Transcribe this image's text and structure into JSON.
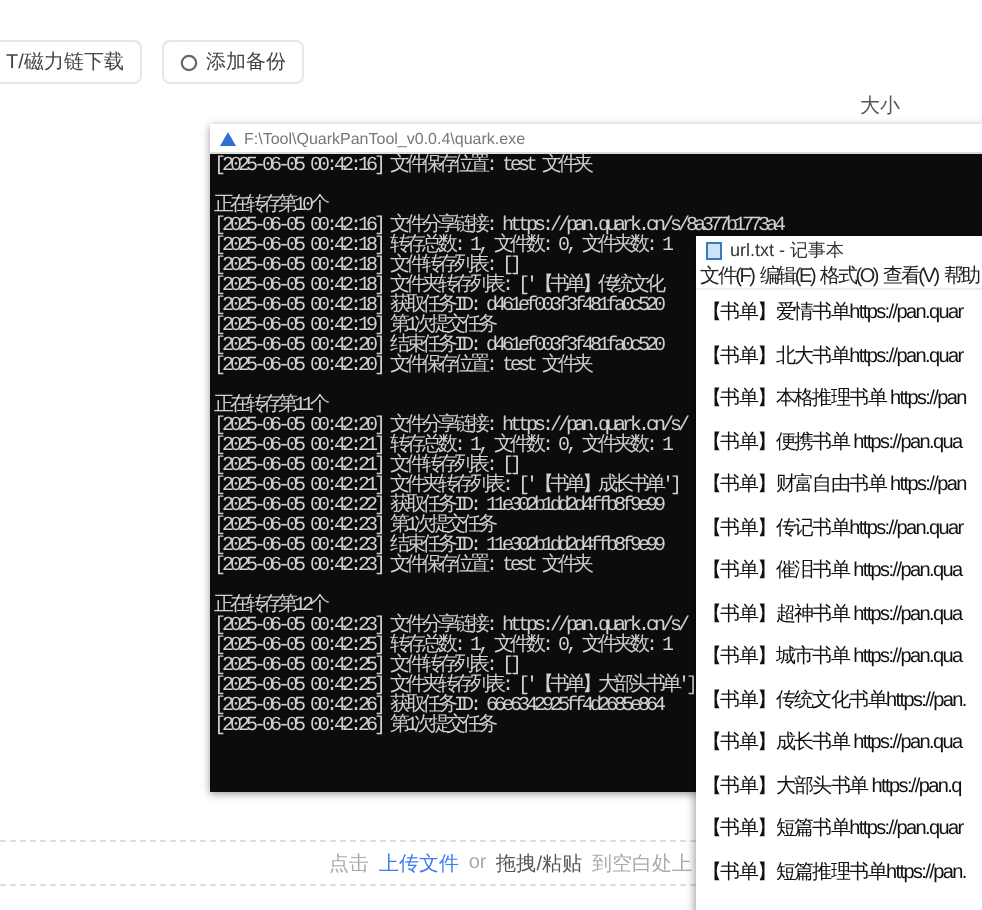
{
  "toolbar": {
    "buttons": [
      {
        "label": "T/磁力链下载",
        "kind": "plain"
      },
      {
        "label": "添加备份",
        "kind": "icon"
      }
    ]
  },
  "table": {
    "columns": [
      "大小"
    ]
  },
  "console": {
    "title": "F:\\Tool\\QuarkPanTool_v0.0.4\\quark.exe",
    "groups": [
      {
        "lines": [
          "[2025-06-05 00:42:16] 文件保存位置: test 文件夹"
        ]
      },
      {
        "heading": "正在转存第10个",
        "lines": [
          "[2025-06-05 00:42:16] 文件分享链接: https://pan.quark.cn/s/8a377b1773a4",
          "[2025-06-05 00:42:18] 转存总数: 1, 文件数: 0, 文件夹数: 1",
          "[2025-06-05 00:42:18] 文件转存列表: []",
          "[2025-06-05 00:42:18] 文件夹转存列表: ['【书单】传统文化",
          "[2025-06-05 00:42:18] 获取任务ID: d461ef003f3f481fa0c520",
          "[2025-06-05 00:42:19] 第1次提交任务",
          "[2025-06-05 00:42:20] 结束任务ID: d461ef003f3f481fa0c520",
          "[2025-06-05 00:42:20] 文件保存位置: test 文件夹"
        ]
      },
      {
        "heading": "正在转存第11个",
        "lines": [
          "[2025-06-05 00:42:20] 文件分享链接: https://pan.quark.cn/s/",
          "[2025-06-05 00:42:21] 转存总数: 1, 文件数: 0, 文件夹数: 1",
          "[2025-06-05 00:42:21] 文件转存列表: []",
          "[2025-06-05 00:42:21] 文件夹转存列表: ['【书单】成长书单']",
          "[2025-06-05 00:42:22] 获取任务ID: 11e302b1dd2d4ffb8f9e99",
          "[2025-06-05 00:42:23] 第1次提交任务",
          "[2025-06-05 00:42:23] 结束任务ID: 11e302b1dd2d4ffb8f9e99",
          "[2025-06-05 00:42:23] 文件保存位置: test 文件夹"
        ]
      },
      {
        "heading": "正在转存第12个",
        "lines": [
          "[2025-06-05 00:42:23] 文件分享链接: https://pan.quark.cn/s/",
          "[2025-06-05 00:42:25] 转存总数: 1, 文件数: 0, 文件夹数: 1",
          "[2025-06-05 00:42:25] 文件转存列表: []",
          "[2025-06-05 00:42:25] 文件夹转存列表: ['【书单】大部头书单']",
          "[2025-06-05 00:42:26] 获取任务ID: 66e6342925ff4d2685e864",
          "[2025-06-05 00:42:26] 第1次提交任务"
        ]
      }
    ]
  },
  "notepad": {
    "title": "url.txt - 记事本",
    "menu": [
      "文件(F)",
      "编辑(E)",
      "格式(O)",
      "查看(V)",
      "帮助"
    ],
    "lines": [
      "【书单】爱情书单https://pan.quar",
      "【书单】北大书单https://pan.quar",
      "【书单】本格推理书单 https://pan",
      "【书单】便携书单 https://pan.qua",
      "【书单】财富自由书单 https://pan",
      "【书单】传记书单https://pan.quar",
      "【书单】催泪书单 https://pan.qua",
      "【书单】超神书单 https://pan.qua",
      "【书单】城市书单 https://pan.qua",
      "【书单】传统文化书单https://pan.",
      "【书单】成长书单 https://pan.qua",
      "【书单】大部头书单 https://pan.q",
      "【书单】短篇书单https://pan.quar",
      "【书单】短篇推理书单https://pan."
    ]
  },
  "upload_hint": {
    "parts": [
      {
        "text": "点击",
        "kind": "plain"
      },
      {
        "text": "上传文件",
        "kind": "link"
      },
      {
        "text": "or",
        "kind": "plain"
      },
      {
        "text": "拖拽/粘贴",
        "kind": "strong"
      },
      {
        "text": "到空白处上",
        "kind": "plain"
      }
    ]
  }
}
